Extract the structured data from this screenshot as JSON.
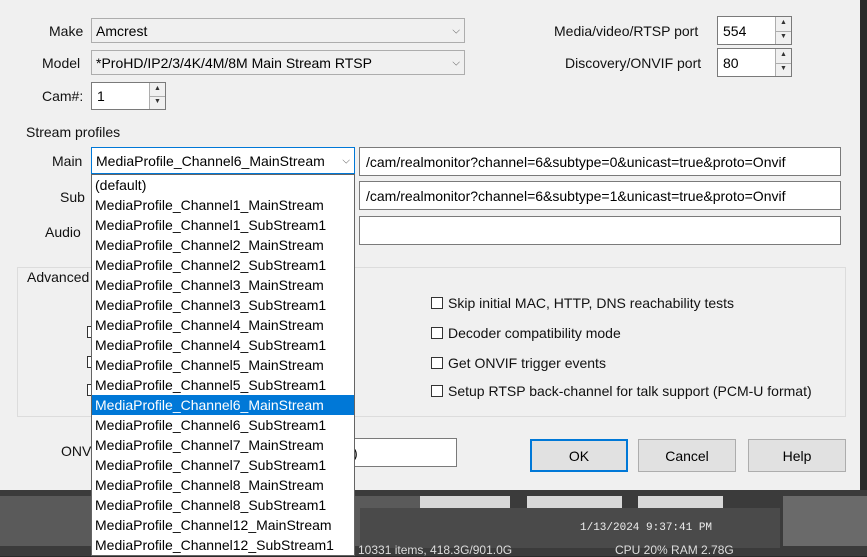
{
  "camera": {
    "make_label": "Make",
    "make_value": "Amcrest",
    "model_label": "Model",
    "model_value": "*ProHD/IP2/3/4K/4M/8M Main Stream RTSP",
    "cam_num_label": "Cam#:",
    "cam_num_value": "1",
    "rtsp_port_label": "Media/video/RTSP port",
    "rtsp_port_value": "554",
    "onvif_port_label": "Discovery/ONVIF port",
    "onvif_port_value": "80"
  },
  "stream_profiles": {
    "group_label": "Stream profiles",
    "main_label": "Main",
    "main_selected": "MediaProfile_Channel6_MainStream",
    "main_path": "/cam/realmonitor?channel=6&subtype=0&unicast=true&proto=Onvif",
    "sub_label": "Sub",
    "sub_path": "/cam/realmonitor?channel=6&subtype=1&unicast=true&proto=Onvif",
    "audio_label": "Audio",
    "audio_path": ""
  },
  "dropdown_options": [
    "(default)",
    "MediaProfile_Channel1_MainStream",
    "MediaProfile_Channel1_SubStream1",
    "MediaProfile_Channel2_MainStream",
    "MediaProfile_Channel2_SubStream1",
    "MediaProfile_Channel3_MainStream",
    "MediaProfile_Channel3_SubStream1",
    "MediaProfile_Channel4_MainStream",
    "MediaProfile_Channel4_SubStream1",
    "MediaProfile_Channel5_MainStream",
    "MediaProfile_Channel5_SubStream1",
    "MediaProfile_Channel6_MainStream",
    "MediaProfile_Channel6_SubStream1",
    "MediaProfile_Channel7_MainStream",
    "MediaProfile_Channel7_SubStream1",
    "MediaProfile_Channel8_MainStream",
    "MediaProfile_Channel8_SubStream1",
    "MediaProfile_Channel12_MainStream",
    "MediaProfile_Channel12_SubStream1"
  ],
  "selected_option_index": 11,
  "advanced": {
    "group_label": "Advanced",
    "options": [
      "Skip initial MAC, HTTP, DNS reachability tests",
      "Decoder compatibility mode",
      "Get ONVIF trigger events",
      "Setup RTSP back-channel for talk support (PCM-U format)"
    ]
  },
  "onvif_label_partial": "ONV",
  "onvif_field_partial": ")",
  "buttons": {
    "ok": "OK",
    "cancel": "Cancel",
    "help": "Help"
  },
  "background": {
    "timestamp_overlay": "1/13/2024 9:37:41 PM",
    "status_items": "10331 items, 418.3G/901.0G",
    "status_cpu": "CPU 20% RAM 2.78G"
  },
  "colors": {
    "selection": "#0078d7",
    "dialog_bg": "#f0f0f0"
  }
}
